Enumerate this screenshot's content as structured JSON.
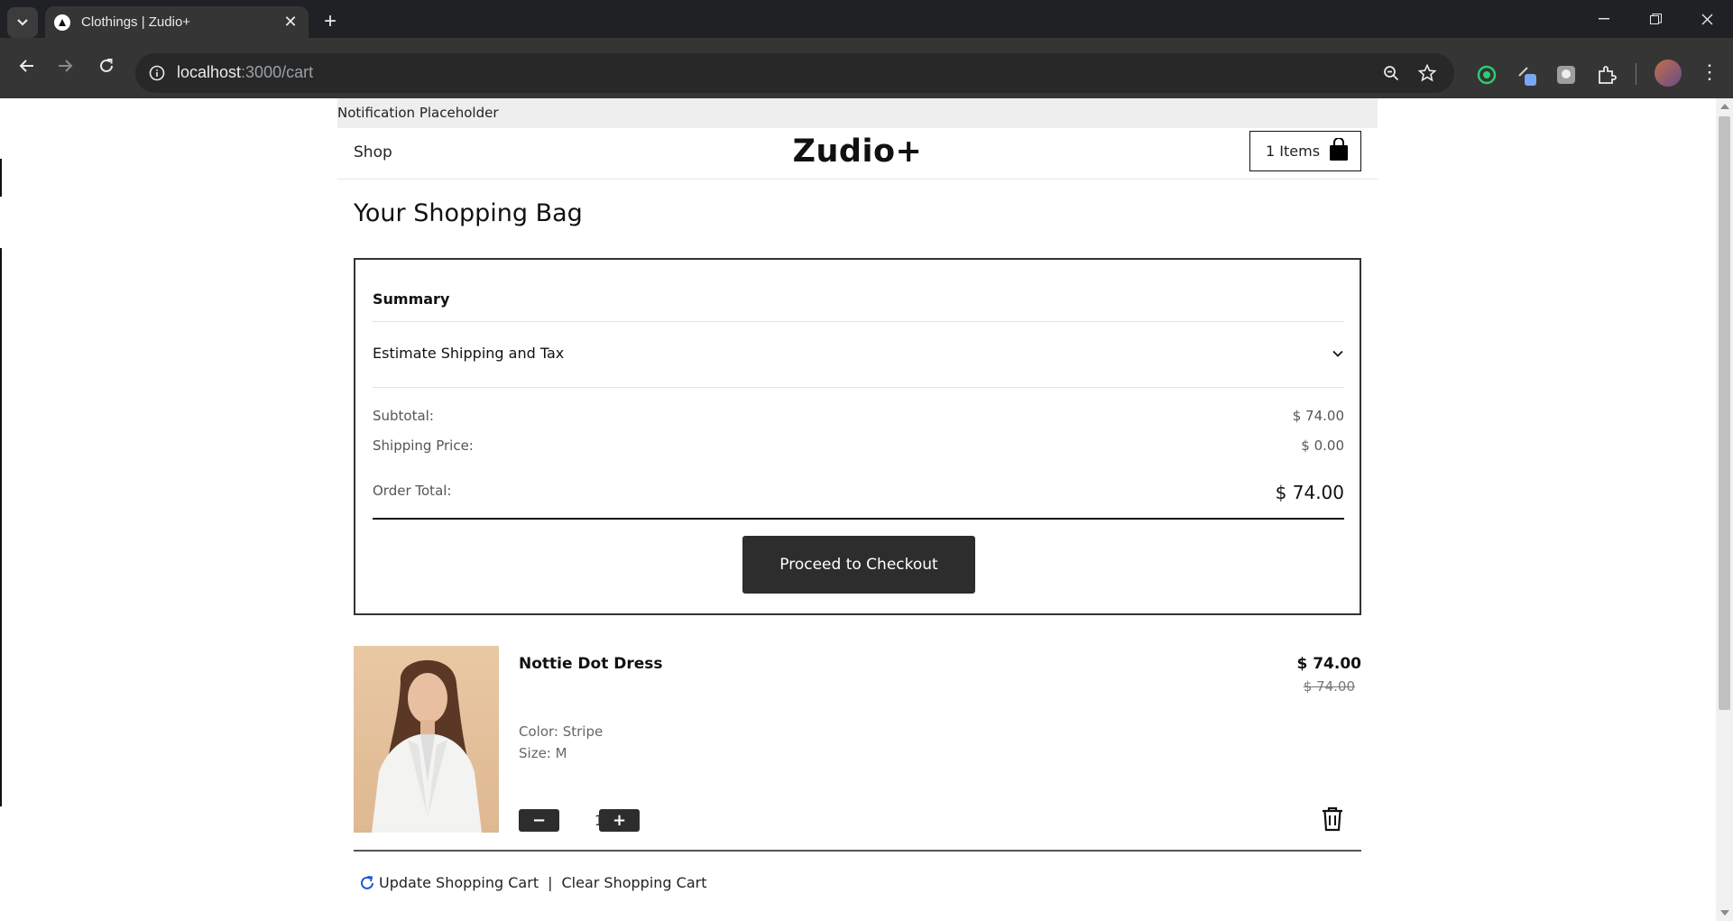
{
  "browser": {
    "tab_title": "Clothings | Zudio+",
    "url_host": "localhost",
    "url_path": ":3000/cart",
    "icons": [
      "tab-search-icon",
      "close-icon",
      "new-tab-icon",
      "minimize-icon",
      "maximize-icon",
      "window-close-icon",
      "back-icon",
      "forward-icon",
      "reload-icon",
      "info-icon",
      "zoom-icon",
      "star-icon",
      "extensions-icon",
      "menu-icon"
    ]
  },
  "page": {
    "notification": "Notification Placeholder",
    "nav": {
      "shop": "Shop"
    },
    "logo": "Zudio+",
    "cart_button": {
      "label": "1 Items",
      "icon": "shopping-bag-icon"
    },
    "title": "Your Shopping Bag",
    "summary": {
      "title": "Summary",
      "estimate_label": "Estimate Shipping and Tax",
      "subtotal_label": "Subtotal:",
      "subtotal_value": "$ 74.00",
      "shipping_label": "Shipping Price:",
      "shipping_value": "$ 0.00",
      "total_label": "Order Total:",
      "total_value": "$ 74.00",
      "checkout_label": "Proceed to Checkout"
    },
    "item": {
      "name": "Nottie Dot Dress",
      "price": "$ 74.00",
      "original_price": "$ 74.00",
      "color": "Color: Stripe",
      "size": "Size: M",
      "quantity": "1",
      "decrement": "−",
      "increment": "+"
    },
    "actions": {
      "update": "Update Shopping Cart",
      "separator": "|",
      "clear": "Clear Shopping Cart"
    }
  },
  "colors": {
    "button_dark": "#2d2d2d",
    "accent_refresh": "#1a56d6"
  }
}
